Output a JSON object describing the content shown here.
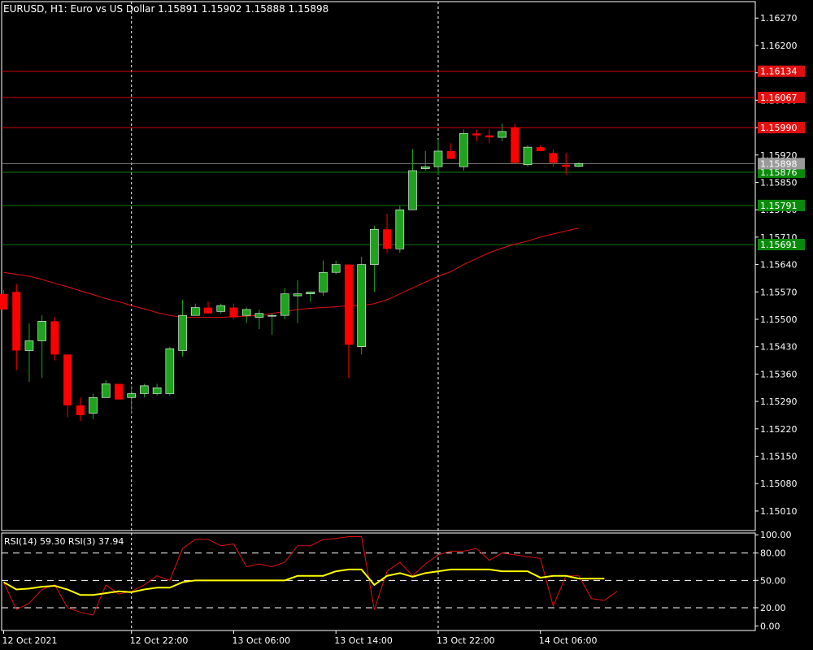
{
  "colors": {
    "background": "#000000",
    "frame": "#ffffff",
    "bull": "#1fa31f",
    "bear": "#ff0000",
    "ma": "#e01010",
    "rsi_fast": "#e01010",
    "rsi_slow": "#ffff00",
    "line_red": "#d00000",
    "line_green": "#0a7a0a",
    "label_red": "#e01010",
    "label_green": "#0a8a0a",
    "label_price": "#9a9a9a"
  },
  "header": {
    "symbol": "EURUSD",
    "timeframe": "H1",
    "description": "Euro vs US Dollar",
    "open": "1.15891",
    "high": "1.15902",
    "low": "1.15888",
    "close": "1.15898"
  },
  "rsi_header": {
    "text": "RSI(14) 59.30 RSI(3) 37.94"
  },
  "chart_data": {
    "type": "candlestick",
    "price_axis": {
      "ylim": [
        1.1496,
        1.16312
      ],
      "ticks": [
        "1.16270",
        "1.16200",
        "1.16130",
        "1.16060",
        "1.15990",
        "1.15920",
        "1.15850",
        "1.15780",
        "1.15710",
        "1.15640",
        "1.15570",
        "1.15500",
        "1.15430",
        "1.15360",
        "1.15290",
        "1.15220",
        "1.15150",
        "1.15080",
        "1.15010"
      ]
    },
    "time_axis": {
      "labels": [
        {
          "text": "12 Oct 2021",
          "index": 0
        },
        {
          "text": "12 Oct 22:00",
          "index": 10
        },
        {
          "text": "13 Oct 06:00",
          "index": 18
        },
        {
          "text": "13 Oct 14:00",
          "index": 26
        },
        {
          "text": "13 Oct 22:00",
          "index": 34
        },
        {
          "text": "14 Oct 06:00",
          "index": 42
        }
      ],
      "separators": [
        10,
        34
      ]
    },
    "levels": [
      {
        "value": 1.16134,
        "label": "1.16134",
        "kind": "red"
      },
      {
        "value": 1.16067,
        "label": "1.16067",
        "kind": "red"
      },
      {
        "value": 1.1599,
        "label": "1.15990",
        "kind": "red"
      },
      {
        "value": 1.15876,
        "label": "1.15876",
        "kind": "green"
      },
      {
        "value": 1.15791,
        "label": "1.15791",
        "kind": "green"
      },
      {
        "value": 1.15691,
        "label": "1.15691",
        "kind": "green"
      }
    ],
    "current_price": {
      "value": 1.15898,
      "label": "1.15898"
    },
    "candles": [
      {
        "o": 1.15565,
        "h": 1.15575,
        "l": 1.15525,
        "c": 1.15525
      },
      {
        "o": 1.1557,
        "h": 1.1559,
        "l": 1.1537,
        "c": 1.1542
      },
      {
        "o": 1.1542,
        "h": 1.1549,
        "l": 1.1534,
        "c": 1.15445
      },
      {
        "o": 1.15445,
        "h": 1.1551,
        "l": 1.1535,
        "c": 1.15495
      },
      {
        "o": 1.15495,
        "h": 1.15505,
        "l": 1.15395,
        "c": 1.1541
      },
      {
        "o": 1.1541,
        "h": 1.1541,
        "l": 1.1525,
        "c": 1.1528
      },
      {
        "o": 1.1528,
        "h": 1.153,
        "l": 1.1524,
        "c": 1.15255
      },
      {
        "o": 1.1526,
        "h": 1.1531,
        "l": 1.15245,
        "c": 1.153
      },
      {
        "o": 1.153,
        "h": 1.15345,
        "l": 1.153,
        "c": 1.15335
      },
      {
        "o": 1.15335,
        "h": 1.15335,
        "l": 1.15295,
        "c": 1.15295
      },
      {
        "o": 1.153,
        "h": 1.1533,
        "l": 1.1526,
        "c": 1.1531
      },
      {
        "o": 1.1531,
        "h": 1.15335,
        "l": 1.153,
        "c": 1.1533
      },
      {
        "o": 1.1531,
        "h": 1.15335,
        "l": 1.15305,
        "c": 1.15325
      },
      {
        "o": 1.1531,
        "h": 1.1543,
        "l": 1.15305,
        "c": 1.15425
      },
      {
        "o": 1.1542,
        "h": 1.1555,
        "l": 1.15405,
        "c": 1.1551
      },
      {
        "o": 1.1551,
        "h": 1.1554,
        "l": 1.1551,
        "c": 1.1553
      },
      {
        "o": 1.1553,
        "h": 1.15545,
        "l": 1.15515,
        "c": 1.15515
      },
      {
        "o": 1.1552,
        "h": 1.1554,
        "l": 1.15515,
        "c": 1.15535
      },
      {
        "o": 1.1553,
        "h": 1.1554,
        "l": 1.155,
        "c": 1.15505
      },
      {
        "o": 1.1551,
        "h": 1.1553,
        "l": 1.1549,
        "c": 1.15525
      },
      {
        "o": 1.15505,
        "h": 1.15525,
        "l": 1.15475,
        "c": 1.15515
      },
      {
        "o": 1.1551,
        "h": 1.15515,
        "l": 1.1546,
        "c": 1.1551
      },
      {
        "o": 1.1551,
        "h": 1.1558,
        "l": 1.155,
        "c": 1.15565
      },
      {
        "o": 1.1556,
        "h": 1.156,
        "l": 1.1549,
        "c": 1.15565
      },
      {
        "o": 1.15565,
        "h": 1.1557,
        "l": 1.15545,
        "c": 1.1557
      },
      {
        "o": 1.1557,
        "h": 1.1565,
        "l": 1.1556,
        "c": 1.1562
      },
      {
        "o": 1.1562,
        "h": 1.1565,
        "l": 1.15615,
        "c": 1.1564
      },
      {
        "o": 1.1564,
        "h": 1.1564,
        "l": 1.1535,
        "c": 1.15435
      },
      {
        "o": 1.1543,
        "h": 1.1566,
        "l": 1.1541,
        "c": 1.1564
      },
      {
        "o": 1.1564,
        "h": 1.1574,
        "l": 1.1557,
        "c": 1.1573
      },
      {
        "o": 1.1573,
        "h": 1.1577,
        "l": 1.1567,
        "c": 1.1568
      },
      {
        "o": 1.1568,
        "h": 1.1579,
        "l": 1.1567,
        "c": 1.1578
      },
      {
        "o": 1.1578,
        "h": 1.15935,
        "l": 1.1578,
        "c": 1.1588
      },
      {
        "o": 1.15885,
        "h": 1.1593,
        "l": 1.1588,
        "c": 1.1589
      },
      {
        "o": 1.1589,
        "h": 1.1596,
        "l": 1.1587,
        "c": 1.1593
      },
      {
        "o": 1.1593,
        "h": 1.1595,
        "l": 1.1591,
        "c": 1.1591
      },
      {
        "o": 1.1589,
        "h": 1.15985,
        "l": 1.1588,
        "c": 1.15975
      },
      {
        "o": 1.15975,
        "h": 1.15985,
        "l": 1.15955,
        "c": 1.1597
      },
      {
        "o": 1.1597,
        "h": 1.15985,
        "l": 1.1595,
        "c": 1.15965
      },
      {
        "o": 1.15965,
        "h": 1.16,
        "l": 1.15955,
        "c": 1.1598
      },
      {
        "o": 1.1599,
        "h": 1.16,
        "l": 1.159,
        "c": 1.159
      },
      {
        "o": 1.15895,
        "h": 1.15945,
        "l": 1.1589,
        "c": 1.1594
      },
      {
        "o": 1.1594,
        "h": 1.15945,
        "l": 1.1593,
        "c": 1.1593
      },
      {
        "o": 1.15925,
        "h": 1.15935,
        "l": 1.1589,
        "c": 1.159
      },
      {
        "o": 1.15895,
        "h": 1.15925,
        "l": 1.1587,
        "c": 1.1589
      },
      {
        "o": 1.15891,
        "h": 1.15902,
        "l": 1.15888,
        "c": 1.15898
      }
    ],
    "moving_average": [
      1.1562,
      1.15615,
      1.1561,
      1.15602,
      1.15592,
      1.15583,
      1.15573,
      1.15563,
      1.15553,
      1.15545,
      1.15535,
      1.15527,
      1.15517,
      1.1551,
      1.15505,
      1.15505,
      1.15505,
      1.15505,
      1.15507,
      1.15508,
      1.1551,
      1.15515,
      1.1552,
      1.15525,
      1.15528,
      1.1553,
      1.15532,
      1.15535,
      1.15535,
      1.1554,
      1.1555,
      1.15565,
      1.1558,
      1.15595,
      1.1561,
      1.15622,
      1.1564,
      1.15655,
      1.1567,
      1.15682,
      1.15692,
      1.157,
      1.1571,
      1.15718,
      1.15726,
      1.15733
    ],
    "rsi": {
      "ylim": [
        0,
        100
      ],
      "ticks": [
        "100.00",
        "80.00",
        "50.00",
        "20.00",
        "0.00"
      ],
      "levels": [
        80,
        50,
        20
      ],
      "rsi14": [
        48,
        40,
        41,
        43,
        44,
        40,
        34,
        34,
        36,
        38,
        37,
        40,
        42,
        42,
        48,
        50,
        50,
        50,
        50,
        50,
        50,
        50,
        50,
        55,
        55,
        55,
        60,
        62,
        62,
        45,
        55,
        58,
        54,
        58,
        60,
        62,
        62,
        62,
        62,
        60,
        60,
        60,
        53,
        55,
        55,
        52,
        52,
        52
      ],
      "rsi3": [
        48,
        18,
        25,
        40,
        45,
        20,
        15,
        12,
        45,
        35,
        38,
        45,
        55,
        50,
        85,
        95,
        95,
        88,
        90,
        65,
        68,
        65,
        70,
        88,
        88,
        95,
        96,
        98,
        98,
        18,
        60,
        70,
        55,
        68,
        78,
        82,
        82,
        85,
        72,
        80,
        78,
        76,
        74,
        22,
        55,
        55,
        30,
        28,
        37.94
      ]
    }
  }
}
